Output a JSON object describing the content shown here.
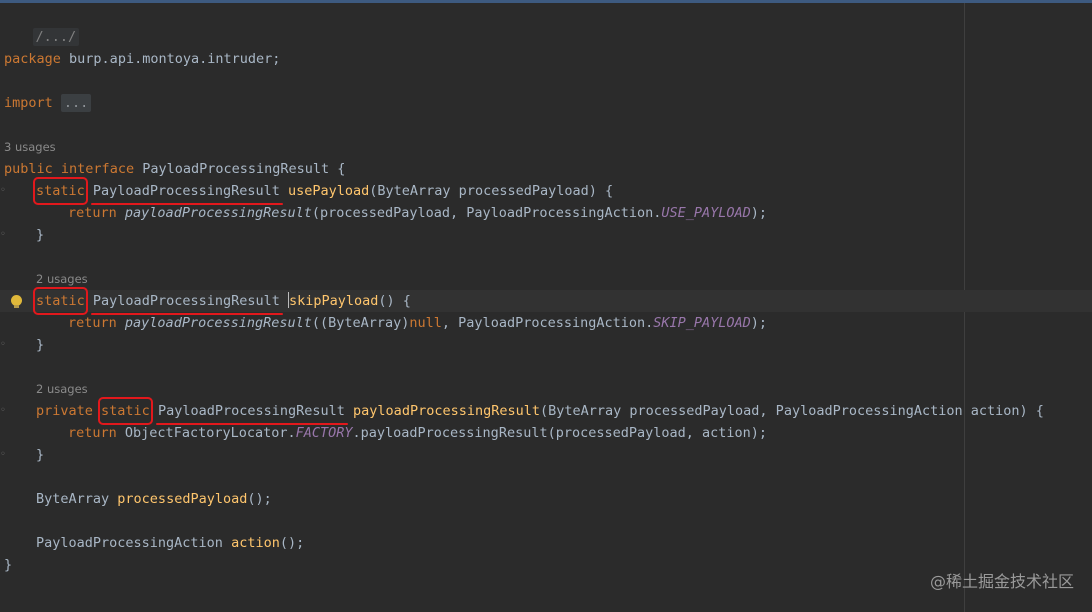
{
  "header_comment": "/.../",
  "package": {
    "keyword": "package",
    "name": "burp.api.montoya.intruder;"
  },
  "import": {
    "keyword": "import",
    "folded": "..."
  },
  "interface": {
    "usages": "3 usages",
    "modifier": "public",
    "keyword": "interface",
    "name": "PayloadProcessingResult",
    "open_brace": "{"
  },
  "methods": [
    {
      "usages": "",
      "visibility": "",
      "static_kw": "static",
      "return_type": "PayloadProcessingResult",
      "name": "usePayload",
      "params": "(ByteArray processedPayload) {",
      "body_kw": "return",
      "body_call": "payloadProcessingResult",
      "body_args_a": "(processedPayload, PayloadProcessingAction.",
      "body_const": "USE_PAYLOAD",
      "body_end": ");",
      "close": "}"
    },
    {
      "usages": "2 usages",
      "visibility": "",
      "static_kw": "static",
      "return_type": "PayloadProcessingResult",
      "name": "skipPayload",
      "params": "() {",
      "body_kw": "return",
      "body_call": "payloadProcessingResult",
      "body_args_a": "((ByteArray)",
      "body_null": "null",
      "body_args_b": ", PayloadProcessingAction.",
      "body_const": "SKIP_PAYLOAD",
      "body_end": ");",
      "close": "}"
    },
    {
      "usages": "2 usages",
      "visibility": "private",
      "static_kw": "static",
      "return_type": "PayloadProcessingResult",
      "name": "payloadProcessingResult",
      "params": "(ByteArray processedPayload, PayloadProcessingAction action) {",
      "body_kw": "return",
      "body_a": "ObjectFactoryLocator.",
      "body_const": "FACTORY",
      "body_b": ".payloadProcessingResult(processedPayload, action);",
      "close": "}"
    }
  ],
  "abstract_methods": [
    {
      "type": "ByteArray",
      "name": "processedPayload",
      "end": "();"
    },
    {
      "type": "PayloadProcessingAction",
      "name": "action",
      "end": "();"
    }
  ],
  "closing_brace": "}",
  "watermark": "@稀土掘金技术社区"
}
